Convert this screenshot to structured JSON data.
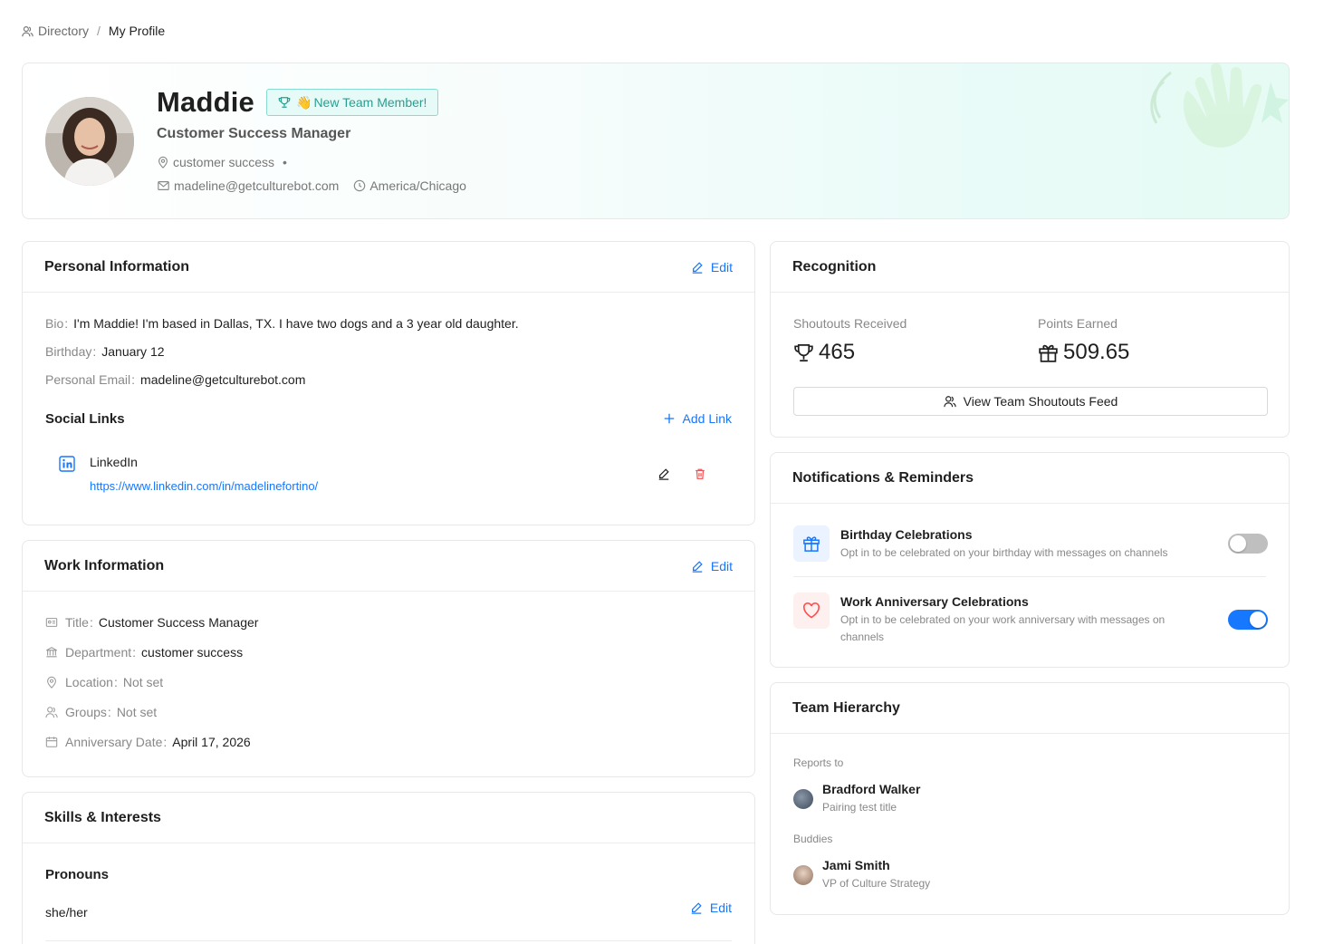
{
  "breadcrumb": {
    "root": "Directory",
    "current": "My Profile"
  },
  "profile": {
    "name": "Maddie",
    "badge": "New Team Member!",
    "badge_emoji": "👋",
    "title": "Customer Success Manager",
    "department": "customer success",
    "email": "madeline@getculturebot.com",
    "timezone": "America/Chicago"
  },
  "personal": {
    "heading": "Personal Information",
    "edit": "Edit",
    "bio_label": "Bio",
    "bio": "I'm Maddie! I'm based in Dallas, TX. I have two dogs and a 3 year old daughter.",
    "birthday_label": "Birthday",
    "birthday": "January 12",
    "email_label": "Personal Email",
    "email": "madeline@getculturebot.com",
    "social_heading": "Social Links",
    "add_link": "Add Link",
    "links": [
      {
        "name": "LinkedIn",
        "url": "https://www.linkedin.com/in/madelinefortino/"
      }
    ]
  },
  "work": {
    "heading": "Work Information",
    "edit": "Edit",
    "title_label": "Title",
    "title": "Customer Success Manager",
    "department_label": "Department",
    "department": "customer success",
    "location_label": "Location",
    "location": "Not set",
    "groups_label": "Groups",
    "groups": "Not set",
    "anniversary_label": "Anniversary Date",
    "anniversary": "April 17, 2026"
  },
  "skills": {
    "heading": "Skills & Interests",
    "pronouns_heading": "Pronouns",
    "pronouns": "she/her",
    "edit": "Edit"
  },
  "recognition": {
    "heading": "Recognition",
    "shoutouts_label": "Shoutouts Received",
    "shoutouts": "465",
    "points_label": "Points Earned",
    "points": "509.65",
    "feed_button": "View Team Shoutouts Feed"
  },
  "notifications": {
    "heading": "Notifications & Reminders",
    "items": [
      {
        "title": "Birthday Celebrations",
        "desc": "Opt in to be celebrated on your birthday with messages on channels",
        "enabled": false
      },
      {
        "title": "Work Anniversary Celebrations",
        "desc_1": "Opt in to be celebrated on your work anniversary with messages on",
        "desc_2": "channels",
        "enabled": true
      }
    ]
  },
  "hierarchy": {
    "heading": "Team Hierarchy",
    "reports_label": "Reports to",
    "manager": {
      "name": "Bradford Walker",
      "title": "Pairing test title"
    },
    "buddies_label": "Buddies",
    "buddy": {
      "name": "Jami Smith",
      "title": "VP of Culture Strategy"
    }
  },
  "colors": {
    "accent": "#1677ff",
    "teal": "#2a9d8f",
    "danger": "#ff4d4f"
  }
}
